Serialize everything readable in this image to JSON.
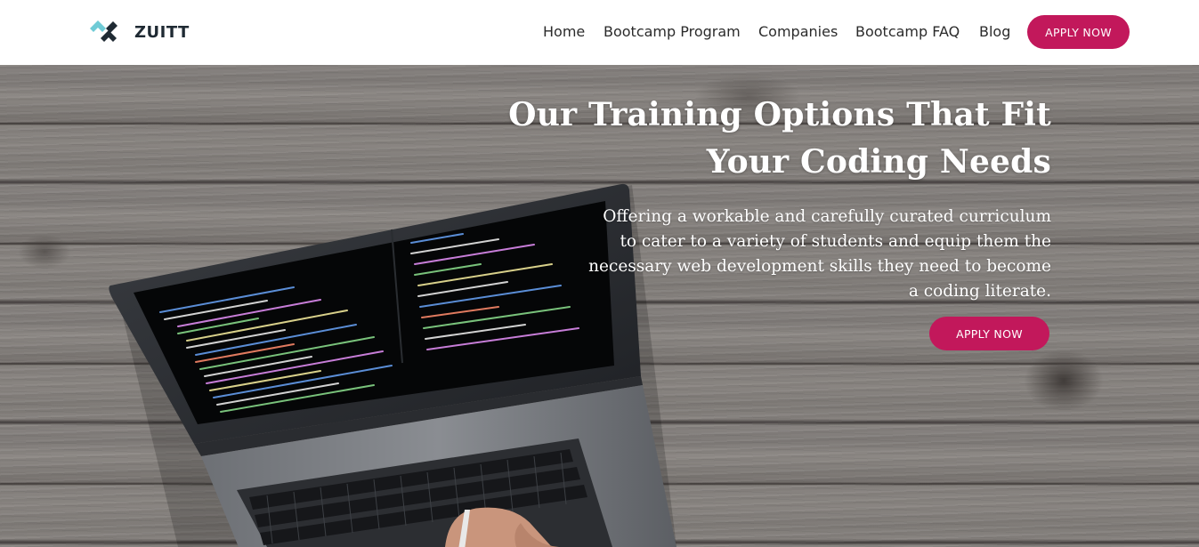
{
  "brand": {
    "name": "ZUITT",
    "colors": {
      "accent": "#c2185b",
      "logo_teal": "#6fcbd6",
      "logo_dark": "#1f2a33"
    }
  },
  "nav": {
    "links": [
      {
        "label": "Home"
      },
      {
        "label": "Bootcamp Program"
      },
      {
        "label": "Companies"
      },
      {
        "label": "Bootcamp FAQ"
      },
      {
        "label": "Blog"
      }
    ],
    "apply_label": "APPLY NOW"
  },
  "hero": {
    "title_line1": "Our Training Options That Fit",
    "title_line2": "Your Coding Needs",
    "subtitle": "Offering a workable and carefully curated curriculum to cater to a variety of students and equip them the necessary web development skills they need to become a coding literate.",
    "apply_label": "APPLY NOW"
  }
}
